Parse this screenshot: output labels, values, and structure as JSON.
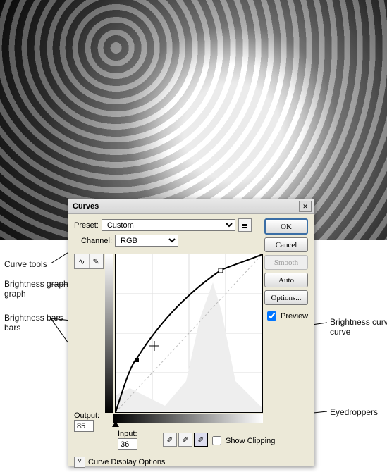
{
  "dialog": {
    "title": "Curves",
    "preset_label": "Preset:",
    "preset_value": "Custom",
    "channel_label": "Channel:",
    "channel_value": "RGB",
    "output_label": "Output:",
    "output_value": "85",
    "input_label": "Input:",
    "input_value": "36",
    "show_clipping_label": "Show Clipping",
    "curve_display_options": "Curve Display Options",
    "buttons": {
      "ok": "OK",
      "cancel": "Cancel",
      "smooth": "Smooth",
      "auto": "Auto",
      "options": "Options..."
    },
    "preview_label": "Preview"
  },
  "annotations": {
    "curve_tools": "Curve tools",
    "brightness_graph": "Brightness graph",
    "brightness_bars": "Brightness bars",
    "brightness_curve": "Brightness curve",
    "eyedroppers": "Eyedroppers"
  },
  "icons": {
    "close": "✕",
    "curve_tool": "∿",
    "pencil_tool": "✎",
    "preset_menu": "≣",
    "expand": "ⱽ",
    "eyedropper": "✐"
  }
}
